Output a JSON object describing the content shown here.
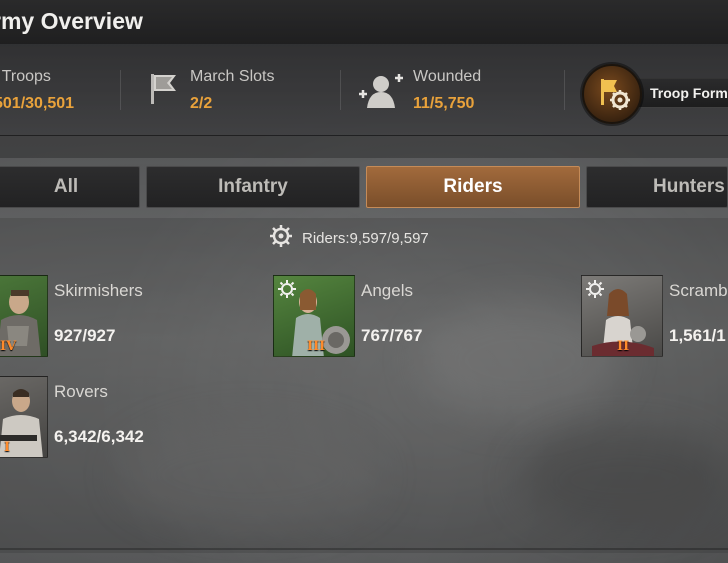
{
  "window": {
    "title": "rmy Overview"
  },
  "stats": {
    "troops": {
      "label": "l Troops",
      "value": "501/30,501"
    },
    "march_slots": {
      "label": "March Slots",
      "value": "2/2"
    },
    "wounded": {
      "label": "Wounded",
      "value": "11/5,750"
    },
    "formation": {
      "label": "Troop Form"
    }
  },
  "tabs": [
    {
      "label": "All",
      "active": false
    },
    {
      "label": "Infantry",
      "active": false
    },
    {
      "label": "Riders",
      "active": true
    },
    {
      "label": "Hunters",
      "active": false
    }
  ],
  "summary": {
    "text": "Riders:9,597/9,597"
  },
  "units": [
    {
      "name": "Skirmishers",
      "count": "927/927",
      "tier": "IV",
      "background": "green",
      "has_gear_badge": false
    },
    {
      "name": "Angels",
      "count": "767/767",
      "tier": "III",
      "background": "green",
      "has_gear_badge": true
    },
    {
      "name": "Scramb",
      "count": "1,561/1",
      "tier": "II",
      "background": "gray",
      "has_gear_badge": true
    },
    {
      "name": "Rovers",
      "count": "6,342/6,342",
      "tier": "I",
      "background": "gray",
      "has_gear_badge": false
    }
  ],
  "colors": {
    "accent_value": "#e9a23b",
    "active_tab": "#a26a3c",
    "tier_text": "#ff8a2a"
  },
  "icons": {
    "march_slots": "flag-icon",
    "wounded": "wounded-soldier-icon",
    "formation": "flag-gear-icon",
    "summary": "gear-icon"
  }
}
